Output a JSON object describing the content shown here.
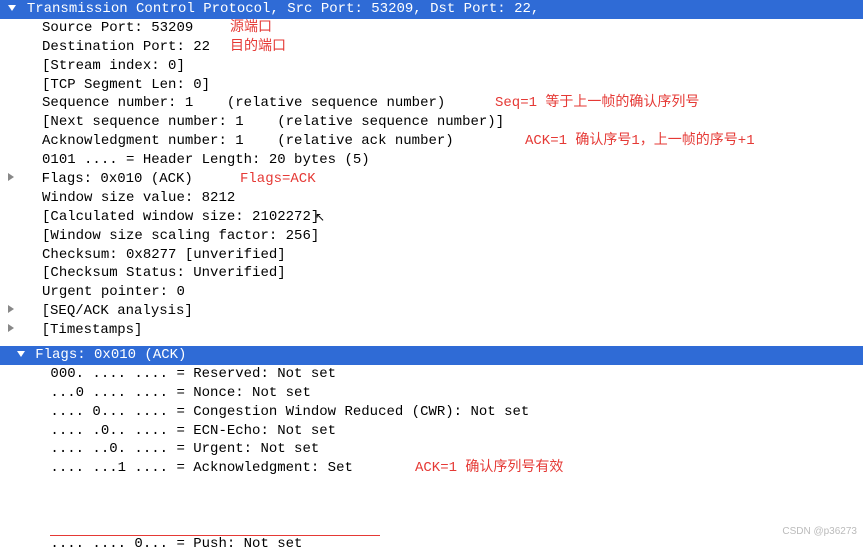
{
  "header": "Transmission Control Protocol, Src Port: 53209, Dst Port: 22,",
  "lines": {
    "src_port": "   Source Port: 53209",
    "dst_port": "   Destination Port: 22",
    "stream": "   [Stream index: 0]",
    "seglen": "   [TCP Segment Len: 0]",
    "seq": "   Sequence number: 1    (relative sequence number)",
    "nextseq": "   [Next sequence number: 1    (relative sequence number)]",
    "ack": "   Acknowledgment number: 1    (relative ack number)",
    "hlen": "   0101 .... = Header Length: 20 bytes (5)",
    "flags": "   Flags: 0x010 (ACK)",
    "winsize": "   Window size value: 8212",
    "calcwin": "   [Calculated window size: 2102272",
    "calcwin_end": "]",
    "scalef": "   [Window size scaling factor: 256]",
    "checksum": "   Checksum: 0x8277 [unverified]",
    "ckstatus": "   [Checksum Status: Unverified]",
    "urgent": "   Urgent pointer: 0",
    "seqack": "   [SEQ/ACK analysis]",
    "timestamps": "   [Timestamps]"
  },
  "flags_header": "Flags: 0x010 (ACK)",
  "flag_bits": {
    "reserved": "    000. .... .... = Reserved: Not set",
    "nonce": "    ...0 .... .... = Nonce: Not set",
    "cwr": "    .... 0... .... = Congestion Window Reduced (CWR): Not set",
    "ecn": "    .... .0.. .... = ECN-Echo: Not set",
    "urg": "    .... ..0. .... = Urgent: Not set",
    "ackb": "    .... ...1 .... = Acknowledgment: Set",
    "psh": "    .... .... 0... = Push: Not set"
  },
  "annotations": {
    "src": "源端口",
    "dst": "目的端口",
    "seq": "Seq=1 等于上一帧的确认序列号",
    "ack": "ACK=1 确认序号1，上一帧的序号+1",
    "flags": "Flags=ACK",
    "ackb": "ACK=1 确认序列号有效"
  },
  "watermark": "CSDN @p36273"
}
